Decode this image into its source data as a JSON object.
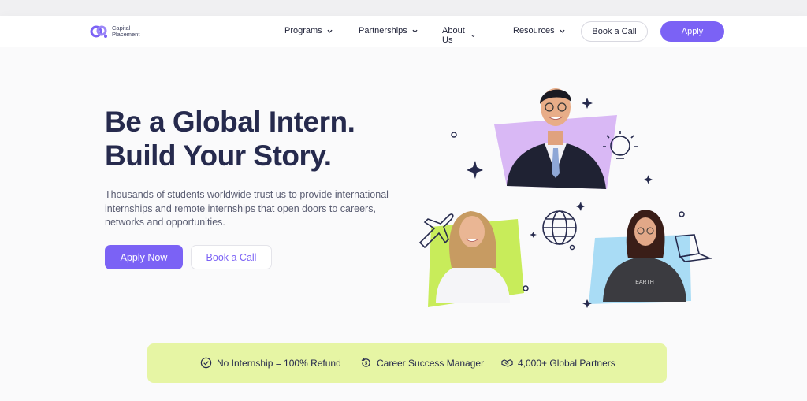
{
  "brand": {
    "name_line1": "Capital",
    "name_line2": "Placement",
    "accent_color": "#7b62f5",
    "logo_icon": "capital-placement-logo-icon"
  },
  "nav": {
    "items": [
      {
        "label": "Programs",
        "icon": "chevron-down-icon"
      },
      {
        "label": "Partnerships",
        "icon": "chevron-down-icon"
      },
      {
        "label": "About Us",
        "icon": "chevron-down-icon"
      },
      {
        "label": "Resources",
        "icon": "chevron-down-icon"
      }
    ],
    "book_label": "Book a Call",
    "apply_label": "Apply"
  },
  "hero": {
    "headline_line1": "Be a Global Intern.",
    "headline_line2": "Build Your Story.",
    "subtext": "Thousands of students worldwide trust us to provide international internships and remote internships that open doors to careers, networks and opportunities.",
    "apply_now_label": "Apply Now",
    "book_call_label": "Book a Call",
    "illustration_icons": [
      "lightbulb-icon",
      "airplane-icon",
      "globe-icon",
      "laptop-icon",
      "sparkle-icon"
    ],
    "tshirt_text": "EARTH"
  },
  "features": [
    {
      "label": "No Internship = 100% Refund",
      "icon": "check-badge-icon"
    },
    {
      "label": "Career Success Manager",
      "icon": "refresh-dollar-icon"
    },
    {
      "label": "4,000+ Global Partners",
      "icon": "handshake-icon"
    }
  ],
  "colors": {
    "features_bg": "#e6f5a4",
    "purple_panel": "#d9b8f5",
    "green_panel": "#c8ec5a",
    "blue_panel": "#a9dcf5"
  }
}
